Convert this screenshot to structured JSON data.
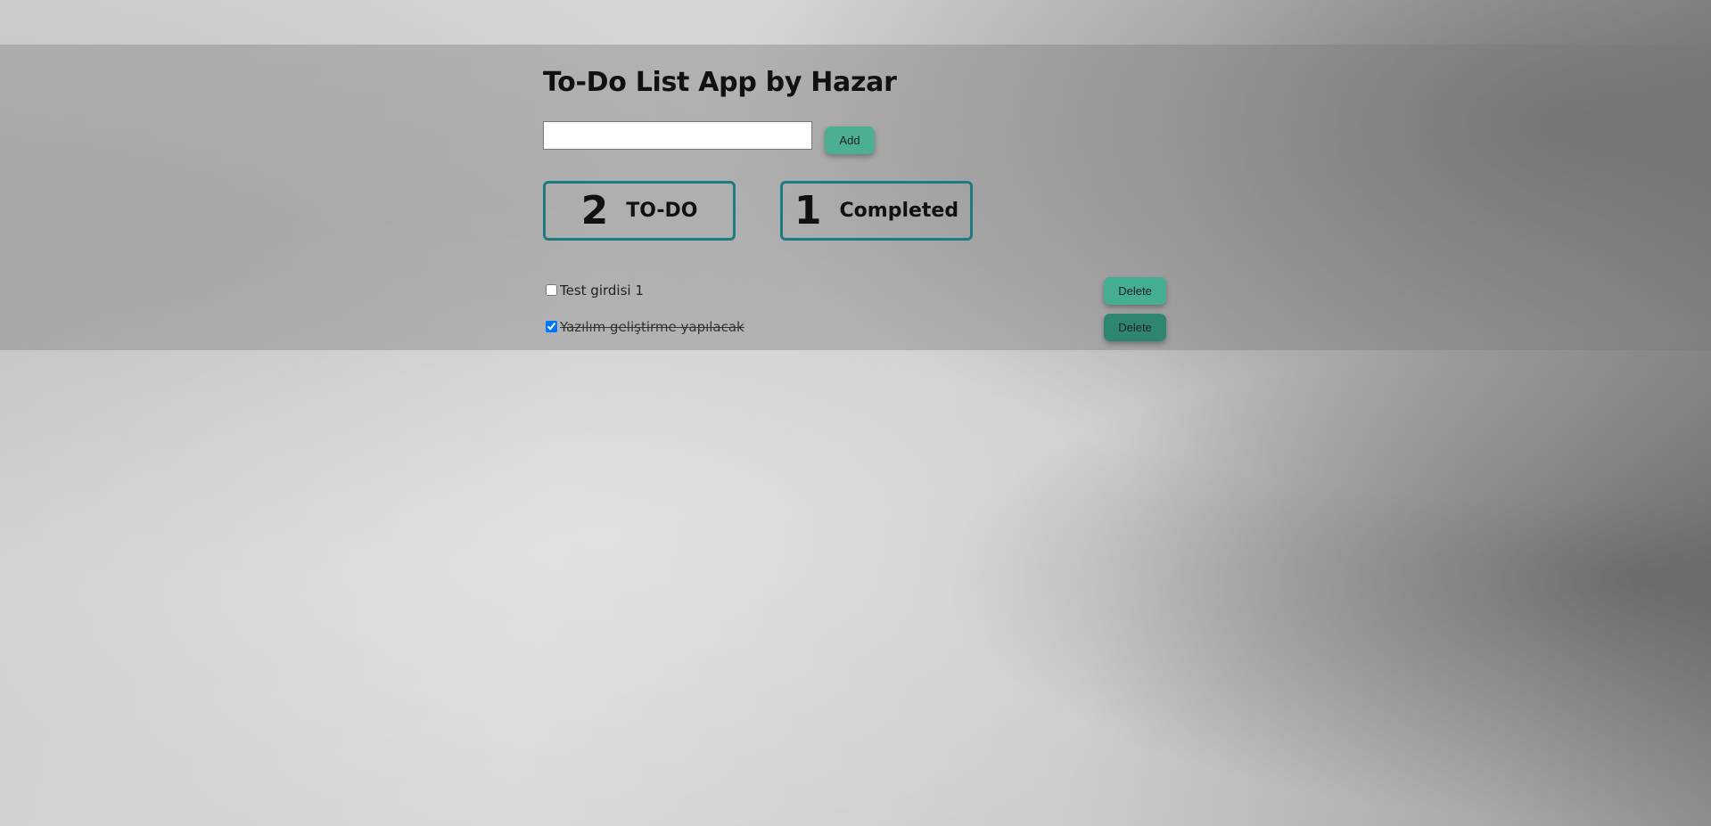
{
  "app": {
    "title": "To-Do List App by Hazar"
  },
  "input": {
    "value": "",
    "placeholder": ""
  },
  "add_button": {
    "label": "Add"
  },
  "stats": {
    "todo": {
      "count": "2",
      "label": "TO-DO"
    },
    "completed": {
      "count": "1",
      "label": "Completed"
    }
  },
  "tasks": [
    {
      "text": "Test girdisi 1",
      "completed": false,
      "delete_label": "Delete"
    },
    {
      "text": "Yazılım geliştirme yapılacak",
      "completed": true,
      "delete_label": "Delete"
    }
  ],
  "colors": {
    "accent_button": "#45ad91",
    "accent_button_active": "#2e8570",
    "stat_border": "#1f7a82"
  }
}
